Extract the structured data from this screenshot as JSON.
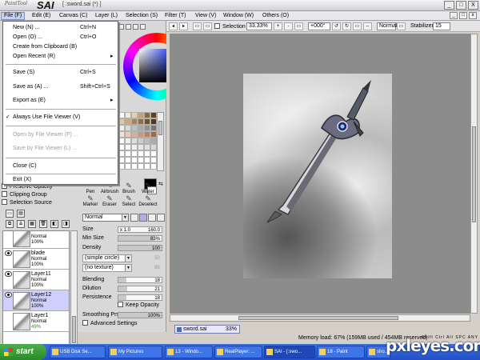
{
  "app": {
    "logo_small": "PaintTool",
    "logo_big": "SAI",
    "document_title": "[ :sword.sai (*) ]",
    "window_buttons": [
      "_",
      "□",
      "X"
    ]
  },
  "menubar": {
    "items": [
      {
        "label": "File (F)"
      },
      {
        "label": "Edit (E)"
      },
      {
        "label": "Canvas (C)"
      },
      {
        "label": "Layer (L)"
      },
      {
        "label": "Selection (S)"
      },
      {
        "label": "Filter (T)"
      },
      {
        "label": "View (V)"
      },
      {
        "label": "Window (W)"
      },
      {
        "label": "Others (O)"
      }
    ]
  },
  "file_menu": {
    "items": [
      {
        "label": "New (N) ...",
        "shortcut": "Ctrl+N"
      },
      {
        "label": "Open (O) ...",
        "shortcut": "Ctrl+O"
      },
      {
        "label": "Create from Clipboard (B)",
        "shortcut": ""
      },
      {
        "label": "Open Recent (R)",
        "shortcut": "▸"
      },
      {
        "label": "Save (S)",
        "shortcut": "Ctrl+S"
      },
      {
        "label": "Save as (A) ...",
        "shortcut": "Shift+Ctrl+S"
      },
      {
        "label": "Export as (E)",
        "shortcut": "▸"
      },
      {
        "label": "Always Use File Viewer (V)",
        "shortcut": ""
      },
      {
        "label": "Open by File Viewer (F) ...",
        "shortcut": ""
      },
      {
        "label": "Save by File Viewer (L) ...",
        "shortcut": ""
      },
      {
        "label": "Close (C)",
        "shortcut": ""
      },
      {
        "label": "Exit (X)",
        "shortcut": ""
      }
    ],
    "checkmark": "✓"
  },
  "layer_options": {
    "preserve_opacity": "Preserve Opacity",
    "clipping_group": "Clipping Group",
    "selection_source": "Selection Source"
  },
  "layers": [
    {
      "name": "",
      "mode": "Normal",
      "opacity": "100%"
    },
    {
      "name": "blade",
      "mode": "Normal",
      "opacity": "100%"
    },
    {
      "name": "Layer11",
      "mode": "Normal",
      "opacity": "100%"
    },
    {
      "name": "Layer12",
      "mode": "Normal",
      "opacity": "100%"
    },
    {
      "name": "Layer1",
      "mode": "Normal",
      "opacity": "49%"
    }
  ],
  "tools": {
    "row1": [
      "Pen",
      "Airbrush",
      "Brush",
      "Water"
    ],
    "row2": [
      "Marker",
      "Eraser",
      "Select",
      "Deselect"
    ],
    "mode": "Normal"
  },
  "brush_params": {
    "size_label": "Size",
    "size_prefix": "x 1.0",
    "size_value": "160.0",
    "min_size_label": "Min Size",
    "min_size_value": "83%",
    "min_size_level": 0.83,
    "density_label": "Density",
    "density_value": "100",
    "shape": "(simple circle)",
    "shape_value": "50",
    "texture": "(no texture)",
    "texture_value": "95",
    "blending_label": "Blending",
    "blending_value": "18",
    "dilution_label": "Dilution",
    "dilution_value": "21",
    "persistence_label": "Persistence",
    "persistence_value": "18",
    "keep_opacity": "Keep Opacity",
    "smoothing_label": "Smoothing Prs",
    "smoothing_value": "100%",
    "advanced": "Advanced Settings"
  },
  "canvas_toolbar": {
    "selection_label": "Selection",
    "zoom": "33.33%",
    "angle": "+000°",
    "blend_mode": "Normal",
    "stabilizer_label": "Stabilizer",
    "stabilizer_value": "15"
  },
  "file_tab": {
    "name": "sword.sai",
    "zoom": "33%"
  },
  "status": {
    "memory": "Memory load: 67% (159MB used / 454MB reserved)",
    "keys": "Shift Ctrl Alt SPC ANY"
  },
  "taskbar": {
    "start": "start",
    "items": [
      {
        "label": "USB Disk Se..."
      },
      {
        "label": "My Pictures"
      },
      {
        "label": "13 - Windo..."
      },
      {
        "label": "RealPlayer: ..."
      },
      {
        "label": "SAI - [:swo..."
      },
      {
        "label": "18 - Paint"
      },
      {
        "label": "sho..."
      }
    ]
  },
  "watermark": "pxleyes.com",
  "colors": {
    "menu_highlight": "#c8d4ee",
    "layer_selected": "#cfcffc",
    "taskbar": "#2350c8",
    "start_green": "#2a8a2a"
  }
}
